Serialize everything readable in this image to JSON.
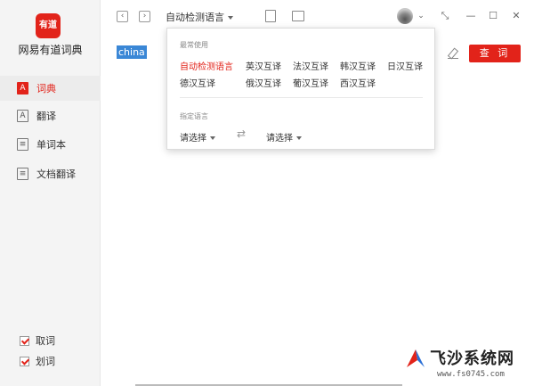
{
  "app": {
    "logo_text": "有道",
    "name": "网易有道词典"
  },
  "sidebar": {
    "items": [
      {
        "label": "词典",
        "icon": "A"
      },
      {
        "label": "翻译",
        "icon": "A"
      },
      {
        "label": "单词本",
        "icon": "≡"
      },
      {
        "label": "文档翻译",
        "icon": "≡"
      }
    ],
    "checks": [
      {
        "label": "取词",
        "checked": true
      },
      {
        "label": "划词",
        "checked": true
      }
    ]
  },
  "topbar": {
    "back": "‹",
    "forward": "›",
    "language_select": "自动检测语言",
    "chevron": "⌄",
    "window": {
      "restore": "⤡",
      "minimize": "—",
      "maximize": "☐",
      "close": "✕"
    }
  },
  "search": {
    "value": "china",
    "query_button": "查 词"
  },
  "dropdown": {
    "frequent_heading": "最常使用",
    "frequent_row1": [
      "自动检测语言",
      "英汉互译",
      "法汉互译",
      "韩汉互译",
      "日汉互译"
    ],
    "frequent_row2": [
      "德汉互译",
      "俄汉互译",
      "葡汉互译",
      "西汉互译"
    ],
    "specify_heading": "指定语言",
    "source_select": "请选择",
    "swap": "⇄",
    "target_select": "请选择"
  },
  "watermark": {
    "title": "飞沙系统网",
    "url": "www.fs0745.com"
  },
  "colors": {
    "accent": "#e2231a",
    "selection": "#3a87d6"
  }
}
